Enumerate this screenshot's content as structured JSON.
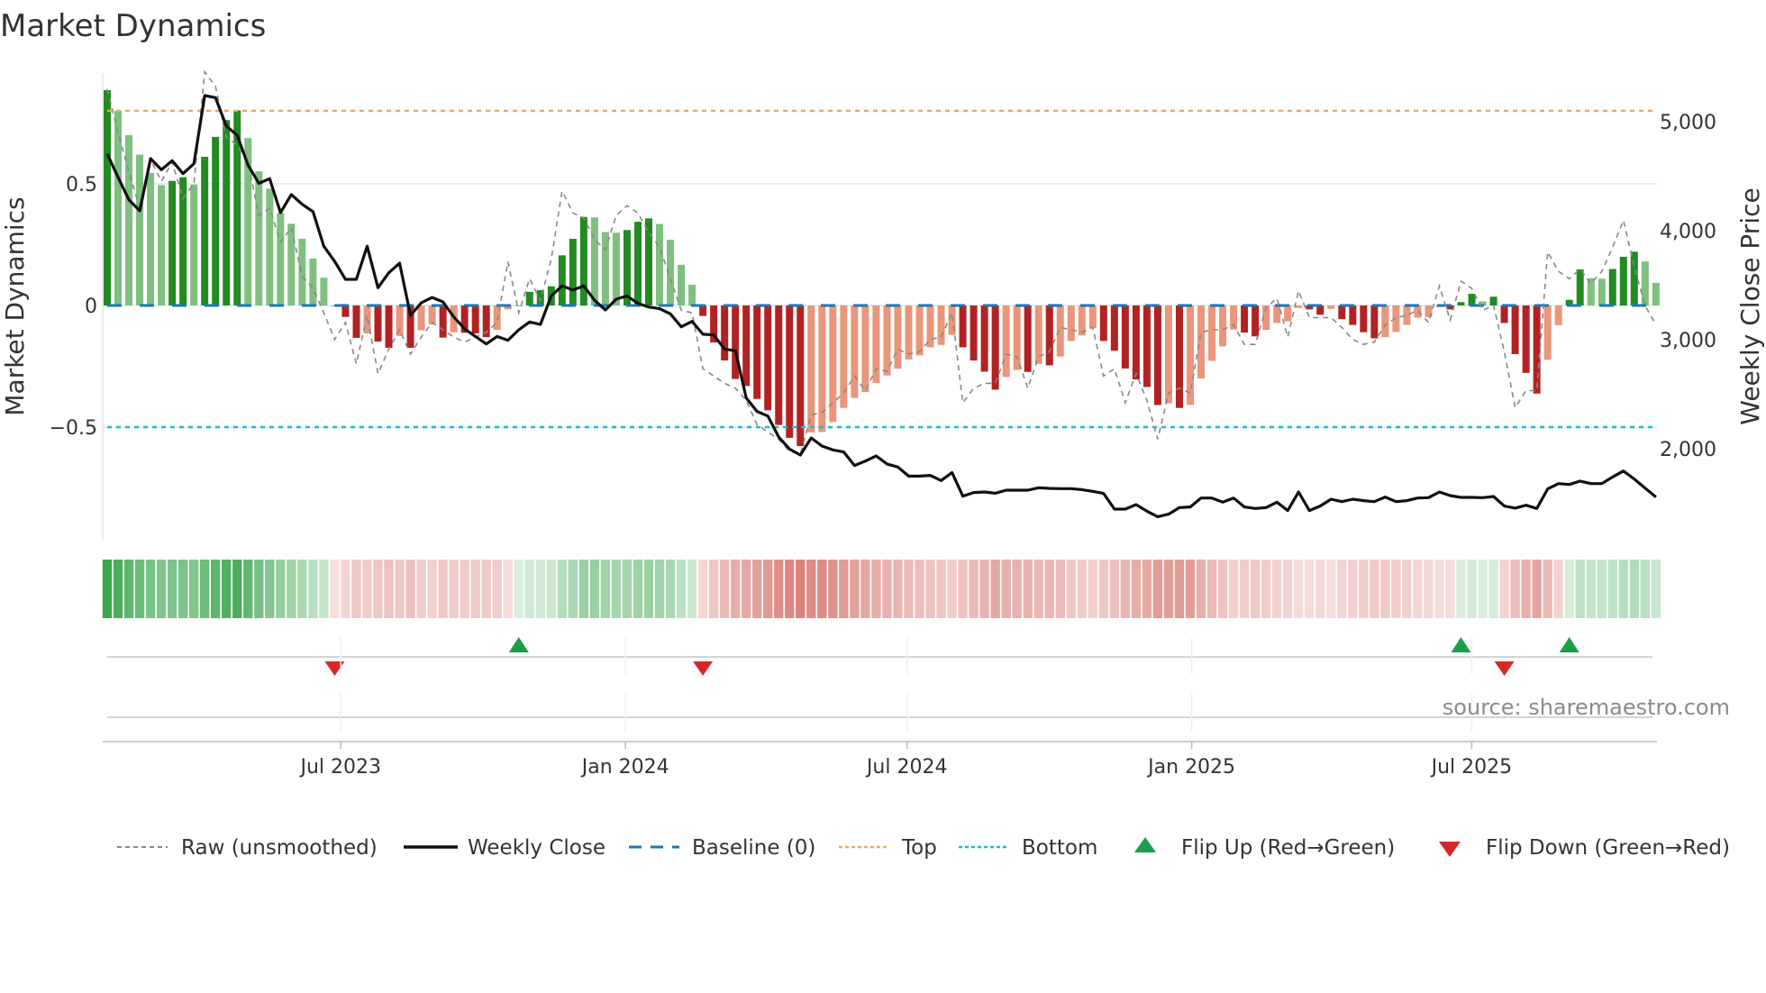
{
  "title": "Market Dynamics",
  "source": "source: sharemaestro.com",
  "colors": {
    "bar_up_strong": "#228b22",
    "bar_up_weak": "#7fbf7f",
    "bar_down_strong": "#b22222",
    "bar_down_weak": "#e9967a",
    "raw": "#888888",
    "close": "#111111",
    "baseline": "#1f77b4",
    "top": "#f4a460",
    "bottom": "#17becf",
    "flip_up": "#1a9e4a",
    "flip_down": "#d62728",
    "strip_green": "#2ea043",
    "strip_red": "#c8463c"
  },
  "chart_data": {
    "type": "bar",
    "title": "Market Dynamics",
    "ylabel": "Market Dynamics",
    "ylabel_right": "Weekly Close Price",
    "ylim": [
      -0.97,
      1.0
    ],
    "ylim_right": [
      1000,
      5500
    ],
    "yticks": [
      {
        "value": 0.5,
        "label": "0.5"
      },
      {
        "value": 0,
        "label": "0"
      },
      {
        "value": -0.5,
        "label": "−0.5"
      }
    ],
    "yticks_right": [
      {
        "value": 5000,
        "label": "5,000"
      },
      {
        "value": 4000,
        "label": "4,000"
      },
      {
        "value": 3000,
        "label": "3,000"
      },
      {
        "value": 2000,
        "label": "2,000"
      }
    ],
    "x_start": "2023-01-31",
    "x_step_days": 7,
    "xticks": [
      {
        "date": "2023-07-01",
        "label": "Jul 2023"
      },
      {
        "date": "2024-01-01",
        "label": "Jan 2024"
      },
      {
        "date": "2024-07-01",
        "label": "Jul 2024"
      },
      {
        "date": "2025-01-01",
        "label": "Jan 2025"
      },
      {
        "date": "2025-07-01",
        "label": "Jul 2025"
      }
    ],
    "reference_lines": {
      "baseline": 0,
      "top": 0.8,
      "bottom": -0.5
    },
    "values": [
      0.885,
      0.8,
      0.7,
      0.62,
      0.545,
      0.495,
      0.512,
      0.527,
      0.497,
      0.611,
      0.693,
      0.762,
      0.802,
      0.688,
      0.552,
      0.48,
      0.38,
      0.336,
      0.274,
      0.193,
      0.114,
      0,
      -0.047,
      -0.133,
      -0.115,
      -0.148,
      -0.174,
      -0.125,
      -0.174,
      -0.102,
      -0.078,
      -0.132,
      -0.11,
      -0.112,
      -0.115,
      -0.13,
      -0.1,
      -0.016,
      0,
      0.056,
      0.063,
      0.079,
      0.206,
      0.274,
      0.364,
      0.362,
      0.302,
      0.299,
      0.31,
      0.344,
      0.358,
      0.335,
      0.27,
      0.167,
      0.085,
      -0.043,
      -0.152,
      -0.226,
      -0.302,
      -0.331,
      -0.384,
      -0.431,
      -0.491,
      -0.544,
      -0.578,
      -0.522,
      -0.52,
      -0.479,
      -0.421,
      -0.38,
      -0.356,
      -0.319,
      -0.288,
      -0.26,
      -0.222,
      -0.205,
      -0.172,
      -0.162,
      -0.121,
      -0.172,
      -0.226,
      -0.272,
      -0.346,
      -0.294,
      -0.265,
      -0.273,
      -0.24,
      -0.246,
      -0.21,
      -0.146,
      -0.123,
      -0.093,
      -0.146,
      -0.186,
      -0.259,
      -0.304,
      -0.335,
      -0.409,
      -0.402,
      -0.421,
      -0.409,
      -0.3,
      -0.228,
      -0.168,
      -0.099,
      -0.111,
      -0.127,
      -0.1,
      -0.072,
      -0.065,
      -0.01,
      -0.016,
      -0.038,
      -0.014,
      -0.056,
      -0.08,
      -0.11,
      -0.135,
      -0.13,
      -0.109,
      -0.08,
      -0.05,
      -0.048,
      -0.007,
      -0.016,
      0.014,
      0.048,
      0.017,
      0.036,
      -0.072,
      -0.2,
      -0.277,
      -0.362,
      -0.223,
      -0.081,
      0.023,
      0.148,
      0.112,
      0.11,
      0.15,
      0.2,
      0.221,
      0.181,
      0.093
    ],
    "raw": [
      0.89,
      0.71,
      0.55,
      0.4,
      0.6,
      0.51,
      0.59,
      0.44,
      0.5,
      0.96,
      0.9,
      0.69,
      0.66,
      0.59,
      0.37,
      0.4,
      0.26,
      0.32,
      0.12,
      0.07,
      -0.03,
      -0.14,
      -0.07,
      -0.24,
      -0.04,
      -0.28,
      -0.18,
      -0.1,
      -0.2,
      -0.13,
      -0.07,
      -0.1,
      -0.13,
      -0.15,
      -0.13,
      -0.11,
      -0.07,
      0.18,
      -0.03,
      0.11,
      0.02,
      0.19,
      0.47,
      0.38,
      0.36,
      0.27,
      0.23,
      0.37,
      0.41,
      0.38,
      0.3,
      0.24,
      0.11,
      -0.02,
      -0.03,
      -0.26,
      -0.29,
      -0.32,
      -0.34,
      -0.39,
      -0.49,
      -0.52,
      -0.55,
      -0.6,
      -0.61,
      -0.45,
      -0.44,
      -0.4,
      -0.36,
      -0.29,
      -0.35,
      -0.26,
      -0.27,
      -0.18,
      -0.2,
      -0.19,
      -0.14,
      -0.13,
      -0.03,
      -0.4,
      -0.34,
      -0.32,
      -0.32,
      -0.2,
      -0.21,
      -0.34,
      -0.21,
      -0.19,
      -0.09,
      -0.1,
      -0.11,
      -0.09,
      -0.29,
      -0.26,
      -0.4,
      -0.28,
      -0.39,
      -0.55,
      -0.36,
      -0.34,
      -0.36,
      -0.11,
      -0.1,
      -0.1,
      -0.08,
      -0.16,
      -0.16,
      -0.01,
      0.03,
      -0.13,
      0.06,
      -0.05,
      -0.05,
      -0.05,
      -0.09,
      -0.14,
      -0.16,
      -0.15,
      -0.08,
      -0.05,
      -0.04,
      -0.02,
      -0.07,
      0.08,
      -0.06,
      0.1,
      0.07,
      -0.02,
      0.0,
      -0.19,
      -0.42,
      -0.35,
      -0.35,
      0.22,
      0.14,
      0.11,
      0.15,
      0.09,
      0.14,
      0.24,
      0.35,
      0.16,
      0.0,
      -0.08
    ],
    "close": [
      4705,
      4490,
      4284,
      4182,
      4661,
      4559,
      4642,
      4523,
      4614,
      5240,
      5220,
      4959,
      4876,
      4601,
      4435,
      4477,
      4165,
      4331,
      4242,
      4174,
      3857,
      3719,
      3554,
      3554,
      3857,
      3477,
      3614,
      3702,
      3223,
      3339,
      3388,
      3347,
      3209,
      3099,
      3030,
      2961,
      3030,
      2995,
      3091,
      3163,
      3140,
      3402,
      3493,
      3455,
      3493,
      3361,
      3273,
      3372,
      3402,
      3333,
      3300,
      3284,
      3237,
      3118,
      3168,
      3050,
      3044,
      2915,
      2898,
      2466,
      2342,
      2300,
      2108,
      1997,
      1942,
      2099,
      2025,
      1989,
      1970,
      1846,
      1887,
      1934,
      1860,
      1832,
      1749,
      1749,
      1755,
      1708,
      1782,
      1565,
      1598,
      1603,
      1592,
      1620,
      1620,
      1620,
      1642,
      1636,
      1634,
      1634,
      1625,
      1609,
      1590,
      1446,
      1446,
      1488,
      1427,
      1377,
      1400,
      1460,
      1466,
      1548,
      1548,
      1510,
      1548,
      1466,
      1452,
      1460,
      1510,
      1433,
      1603,
      1433,
      1474,
      1537,
      1515,
      1537,
      1524,
      1515,
      1557,
      1515,
      1524,
      1548,
      1551,
      1603,
      1570,
      1554,
      1554,
      1551,
      1562,
      1474,
      1455,
      1482,
      1452,
      1631,
      1680,
      1672,
      1703,
      1680,
      1680,
      1741,
      1796,
      1722,
      1639,
      1557
    ],
    "flips": [
      {
        "week": 22,
        "type": "down"
      },
      {
        "week": 39,
        "type": "up"
      },
      {
        "week": 56,
        "type": "down"
      },
      {
        "week": 126,
        "type": "up"
      },
      {
        "week": 130,
        "type": "down"
      },
      {
        "week": 136,
        "type": "up"
      }
    ],
    "initial_regime": "up",
    "grid": true,
    "legend_position": "bottom",
    "legend": [
      "Raw (unsmoothed)",
      "Weekly Close",
      "Baseline (0)",
      "Top",
      "Bottom",
      "Flip Up (Red→Green)",
      "Flip Down (Green→Red)"
    ]
  }
}
